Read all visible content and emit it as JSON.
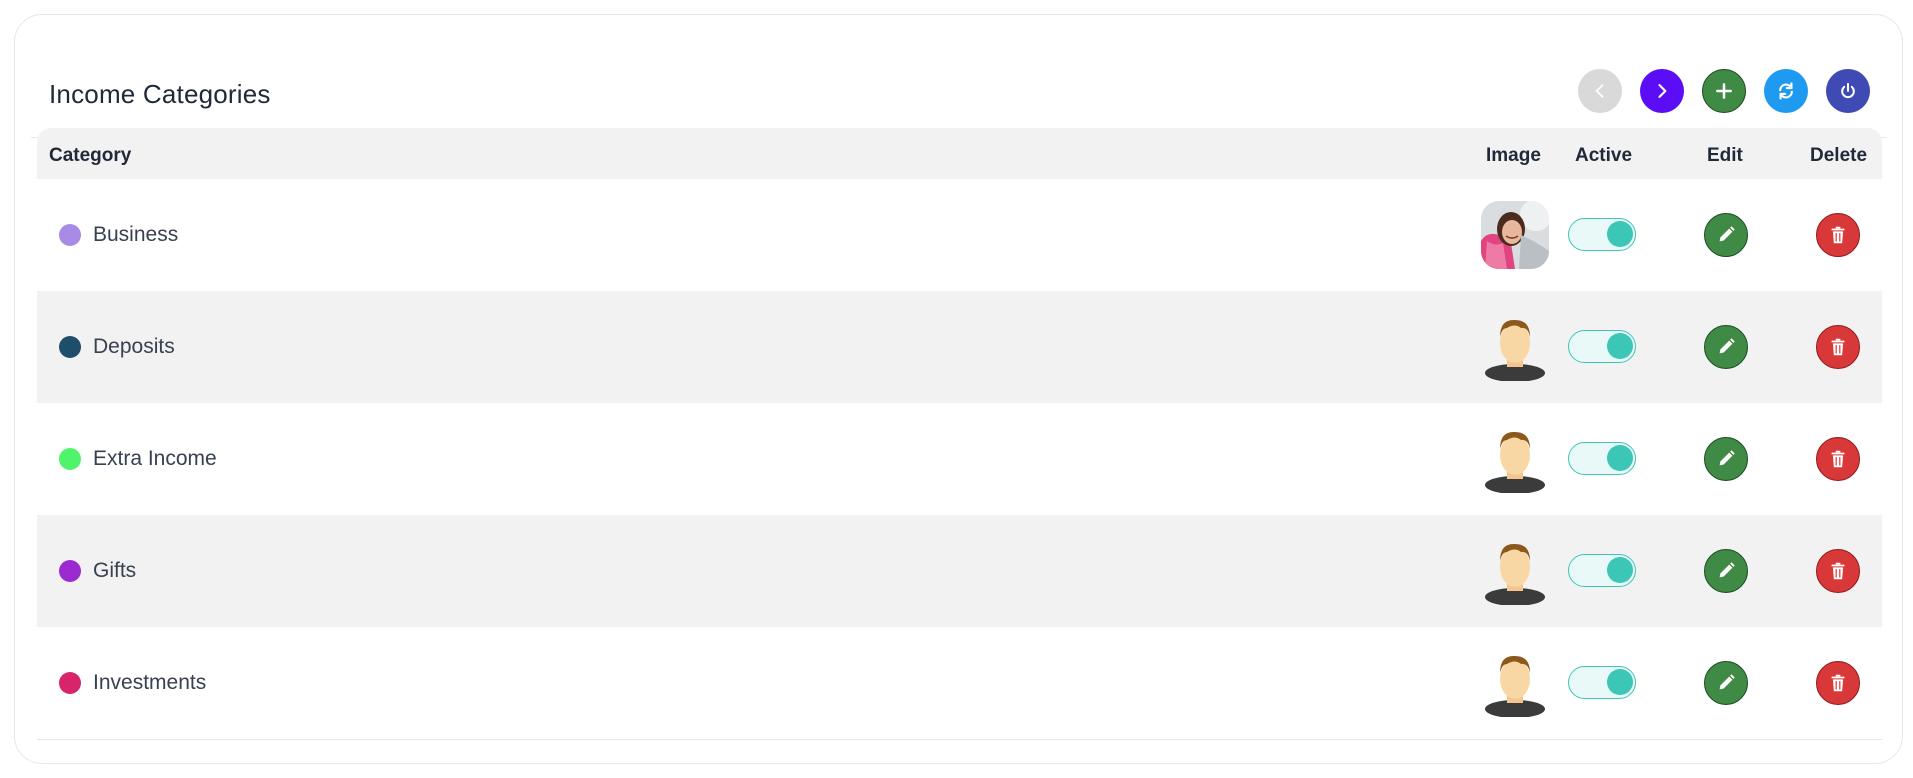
{
  "header": {
    "title": "Income Categories"
  },
  "toolbar": {
    "buttons": [
      {
        "name": "previous",
        "icon": "chevron-left-icon",
        "color": "#d9d9d9",
        "enabled": false
      },
      {
        "name": "next",
        "icon": "chevron-right-icon",
        "color": "#5b0ef5"
      },
      {
        "name": "add",
        "icon": "plus-icon",
        "color": "#3f8a45"
      },
      {
        "name": "refresh",
        "icon": "refresh-icon",
        "color": "#1e9bf0"
      },
      {
        "name": "power",
        "icon": "power-icon",
        "color": "#3f4ab4"
      }
    ]
  },
  "table": {
    "columns": {
      "category": "Category",
      "image": "Image",
      "active": "Active",
      "edit": "Edit",
      "delete": "Delete"
    },
    "rows": [
      {
        "name": "Business",
        "color": "#a78be6",
        "image": "photo-avatar",
        "active": true
      },
      {
        "name": "Deposits",
        "color": "#1f4e6b",
        "image": "default-avatar",
        "active": true
      },
      {
        "name": "Extra Income",
        "color": "#4ff46a",
        "image": "default-avatar",
        "active": true
      },
      {
        "name": "Gifts",
        "color": "#9b2bd0",
        "image": "default-avatar",
        "active": true
      },
      {
        "name": "Investments",
        "color": "#d8246a",
        "image": "default-avatar",
        "active": true
      }
    ]
  }
}
